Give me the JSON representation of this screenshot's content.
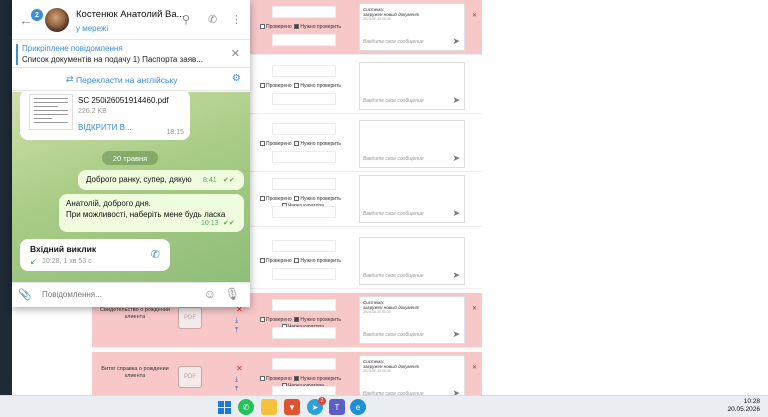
{
  "background_page": {
    "rows": [
      {
        "style": "pink",
        "doc_name": "",
        "checks": [
          "Проверено",
          "Нужно проверить"
        ],
        "check_on": [
          false,
          true
        ],
        "curator": "",
        "msg_sys": "Система:",
        "msg_body": "загружен новый документ",
        "msg_date": "2024-06-30 00:00",
        "msg_placeholder": "Введите свое сообщение"
      },
      {
        "style": "white",
        "doc_name": "",
        "checks": [
          "Проверено",
          "Нужно проверить"
        ],
        "check_on": [
          false,
          false
        ],
        "curator": "",
        "msg_sys": "",
        "msg_body": "",
        "msg_date": "",
        "msg_placeholder": "Введите свое сообщение"
      },
      {
        "style": "white",
        "doc_name": "",
        "checks": [
          "Проверено",
          "Нужно проверить"
        ],
        "check_on": [
          false,
          false
        ],
        "curator": "",
        "msg_sys": "",
        "msg_body": "",
        "msg_date": "",
        "msg_placeholder": "Введите свое сообщение"
      },
      {
        "style": "white",
        "doc_name": "",
        "checks": [
          "Проверено",
          "Нужно проверить"
        ],
        "check_on": [
          false,
          false
        ],
        "curator": "Через куратора",
        "msg_sys": "",
        "msg_body": "",
        "msg_date": "",
        "msg_placeholder": "Введите свое сообщение"
      },
      {
        "style": "white",
        "doc_name": "",
        "checks": [
          "Проверено",
          "Нужно проверить"
        ],
        "check_on": [
          false,
          false
        ],
        "curator": "",
        "msg_sys": "",
        "msg_body": "",
        "msg_date": "",
        "msg_placeholder": "Введите свое сообщение"
      },
      {
        "style": "pink",
        "doc_name": "Свидетельство о рождении клиента",
        "checks": [
          "Проверено",
          "Нужно проверить"
        ],
        "check_on": [
          false,
          true
        ],
        "curator": "Через куратора",
        "msg_sys": "Система:",
        "msg_body": "загружен новый документ",
        "msg_date": "2024-06-30 00:00",
        "msg_placeholder": "Введите свое сообщение"
      },
      {
        "style": "pink",
        "doc_name": "Витяг справка о рождении клиента",
        "checks": [
          "Проверено",
          "Нужно проверить"
        ],
        "check_on": [
          false,
          true
        ],
        "curator": "Через куратора",
        "msg_sys": "Система:",
        "msg_body": "загружен новый документ",
        "msg_date": "2024-06-30 00:00",
        "msg_placeholder": "Введите свое сообщение"
      }
    ],
    "pdf_label": "PDF"
  },
  "telegram": {
    "unread_count": "2",
    "contact_name": "Костенюк Анатолий Ва...",
    "status": "у мережі",
    "pinned_title": "Прикріплене повідомлення",
    "pinned_text": "Список документів на подачу  1) Паспорта заяв...",
    "translate_label": "Перекласти на англійську",
    "file": {
      "name": "SC 250i26051914460.pdf",
      "size": "226.2 KB",
      "open": "ВІДКРИТИ В...",
      "time": "18:15"
    },
    "date_separator": "20 травня",
    "msg1": {
      "text": "Доброго ранку, супер, дякую",
      "time": "8:41"
    },
    "msg2": {
      "line1": "Анатолій, доброго дня.",
      "line2": "При можливості, наберіть мене будь ласка",
      "time": "10:13"
    },
    "call": {
      "title": "Вхідний виклик",
      "info": "10:28, 1 хв 53 с"
    },
    "composer_placeholder": "Повідомлення..."
  },
  "taskbar": {
    "telegram_badge": "2",
    "time": "10:28",
    "date": "20.05.2026"
  }
}
